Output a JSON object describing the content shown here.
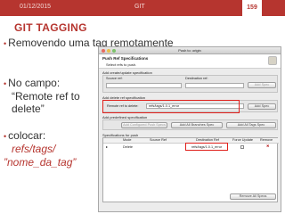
{
  "slide": {
    "date": "01/12/2015",
    "section": "GIT",
    "page": "159",
    "title": "GIT TAGGING",
    "bullet1": "Removendo uma tag remotamente",
    "bullet2_line1": "No campo:",
    "bullet2_line2": "“Remote ref to delete”",
    "bullet3_line1": "colocar:",
    "bullet3_line2": "refs/tags/",
    "bullet3_line3": "”nome_da_tag”"
  },
  "dialog": {
    "window_title": "Push to: origin",
    "header_title": "Push Ref Specifications",
    "header_subtitle": "Select refs to push.",
    "create_section": "Add create/update specification",
    "source_ref_label": "Source ref:",
    "destination_ref_label": "Destination ref:",
    "add_spec_label": "Add Spec",
    "delete_section": "Add delete ref specification",
    "remote_ref_label": "Remote ref to delete:",
    "remote_ref_value": "refs/tags/1.0.1_error",
    "predefined_section": "Add predefined specification",
    "add_configured_label": "Add Configured Push Specs",
    "add_all_branches_label": "Add All Branches Spec",
    "add_all_tags_label": "Add All Tags Spec",
    "specs_section": "Specifications for push",
    "columns": {
      "mode": "Mode",
      "source_ref": "Source Ref",
      "destination_ref": "Destination Ref",
      "force_update": "Force Update",
      "remove": "Remove"
    },
    "rows": [
      {
        "mode": "Delete",
        "destination_ref": "refs/tags/1.0.1_error"
      }
    ],
    "remove_all_label": "Remove All Specs"
  }
}
